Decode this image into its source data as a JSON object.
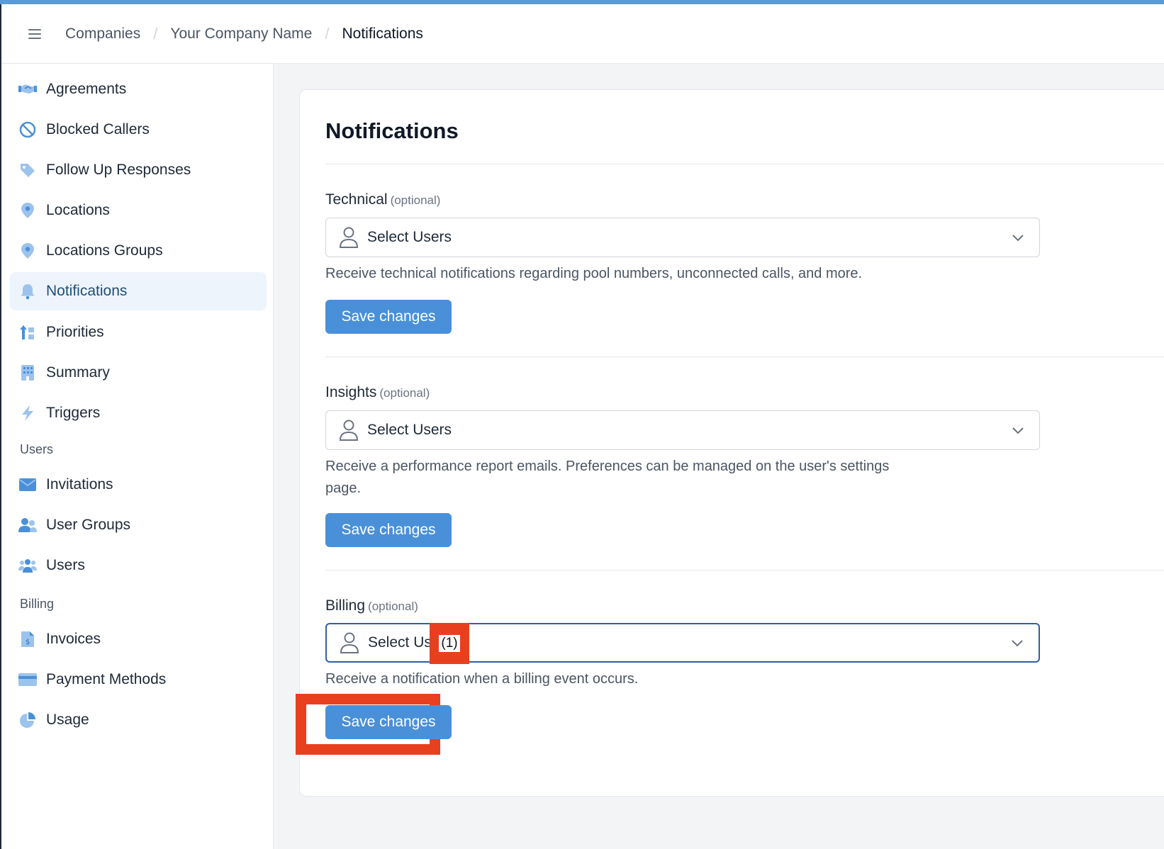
{
  "header": {
    "breadcrumb": [
      "Companies",
      "Your Company Name",
      "Notifications"
    ]
  },
  "sidebar": {
    "items": [
      {
        "label": "Agreements",
        "icon": "handshake-icon"
      },
      {
        "label": "Blocked Callers",
        "icon": "blocked-icon"
      },
      {
        "label": "Follow Up Responses",
        "icon": "tag-icon"
      },
      {
        "label": "Locations",
        "icon": "location-pin-icon"
      },
      {
        "label": "Locations Groups",
        "icon": "location-pin-icon"
      },
      {
        "label": "Notifications",
        "icon": "bell-icon",
        "active": true
      },
      {
        "label": "Priorities",
        "icon": "priority-icon"
      },
      {
        "label": "Summary",
        "icon": "building-icon"
      },
      {
        "label": "Triggers",
        "icon": "lightning-icon"
      }
    ],
    "users_section": "Users",
    "users_items": [
      {
        "label": "Invitations",
        "icon": "envelope-icon"
      },
      {
        "label": "User Groups",
        "icon": "user-group-icon"
      },
      {
        "label": "Users",
        "icon": "users-icon"
      }
    ],
    "billing_section": "Billing",
    "billing_items": [
      {
        "label": "Invoices",
        "icon": "invoice-icon"
      },
      {
        "label": "Payment Methods",
        "icon": "credit-card-icon"
      },
      {
        "label": "Usage",
        "icon": "pie-chart-icon"
      }
    ]
  },
  "main": {
    "title": "Notifications",
    "sections": [
      {
        "label": "Technical",
        "optional": "(optional)",
        "select_text": "Select Users",
        "help": "Receive technical notifications regarding pool numbers, unconnected calls, and more.",
        "button": "Save changes"
      },
      {
        "label": "Insights",
        "optional": "(optional)",
        "select_text": "Select Users",
        "help": "Receive a performance report emails. Preferences can be managed on the user's settings page.",
        "button": "Save changes"
      },
      {
        "label": "Billing",
        "optional": "(optional)",
        "select_text": "Select User",
        "selected_count": "(1)",
        "help": "Receive a notification when a billing event occurs.",
        "button": "Save changes"
      }
    ]
  },
  "colors": {
    "accent": "#4a90d9",
    "active_bg": "#eef4fc",
    "annotation": "#e8401f",
    "focus_border": "#2f5fa8"
  }
}
